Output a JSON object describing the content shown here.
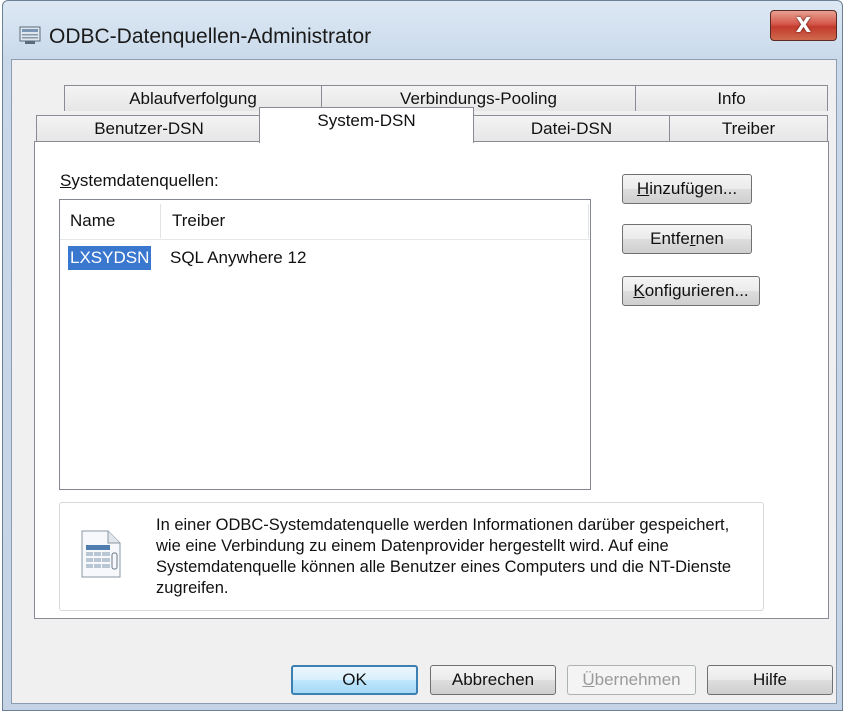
{
  "window": {
    "title": "ODBC-Datenquellen-Administrator",
    "close_glyph": "X"
  },
  "tabs": {
    "row_back": [
      "Ablaufverfolgung",
      "Verbindungs-Pooling",
      "Info"
    ],
    "row_front": [
      "Benutzer-DSN",
      "System-DSN",
      "Datei-DSN",
      "Treiber"
    ],
    "active": "System-DSN"
  },
  "system_dsn": {
    "list_label_first": "S",
    "list_label_rest": "ystemdatenquellen:",
    "columns": [
      "Name",
      "Treiber"
    ],
    "rows": [
      {
        "name": "LXSYDSN",
        "driver": "SQL Anywhere 12"
      }
    ],
    "buttons": {
      "add_first": "H",
      "add_rest": "inzufügen...",
      "remove_pre": "Entfe",
      "remove_u": "r",
      "remove_post": "nen",
      "configure_first": "K",
      "configure_rest": "onfigurieren..."
    },
    "info_text": "In einer ODBC-Systemdatenquelle werden Informationen darüber gespeichert, wie eine Verbindung zu einem Datenprovider hergestellt wird. Auf eine Systemdatenquelle können alle Benutzer eines Computers und die NT-Dienste zugreifen."
  },
  "footer": {
    "ok": "OK",
    "cancel": "Abbrechen",
    "apply_first": "Ü",
    "apply_rest": "bernehmen",
    "help": "Hilfe"
  },
  "colors": {
    "selection": "#3a77cf",
    "close_button": "#c94a3a"
  },
  "icons": [
    "odbc-app-icon",
    "close-icon",
    "data-source-info-icon"
  ]
}
